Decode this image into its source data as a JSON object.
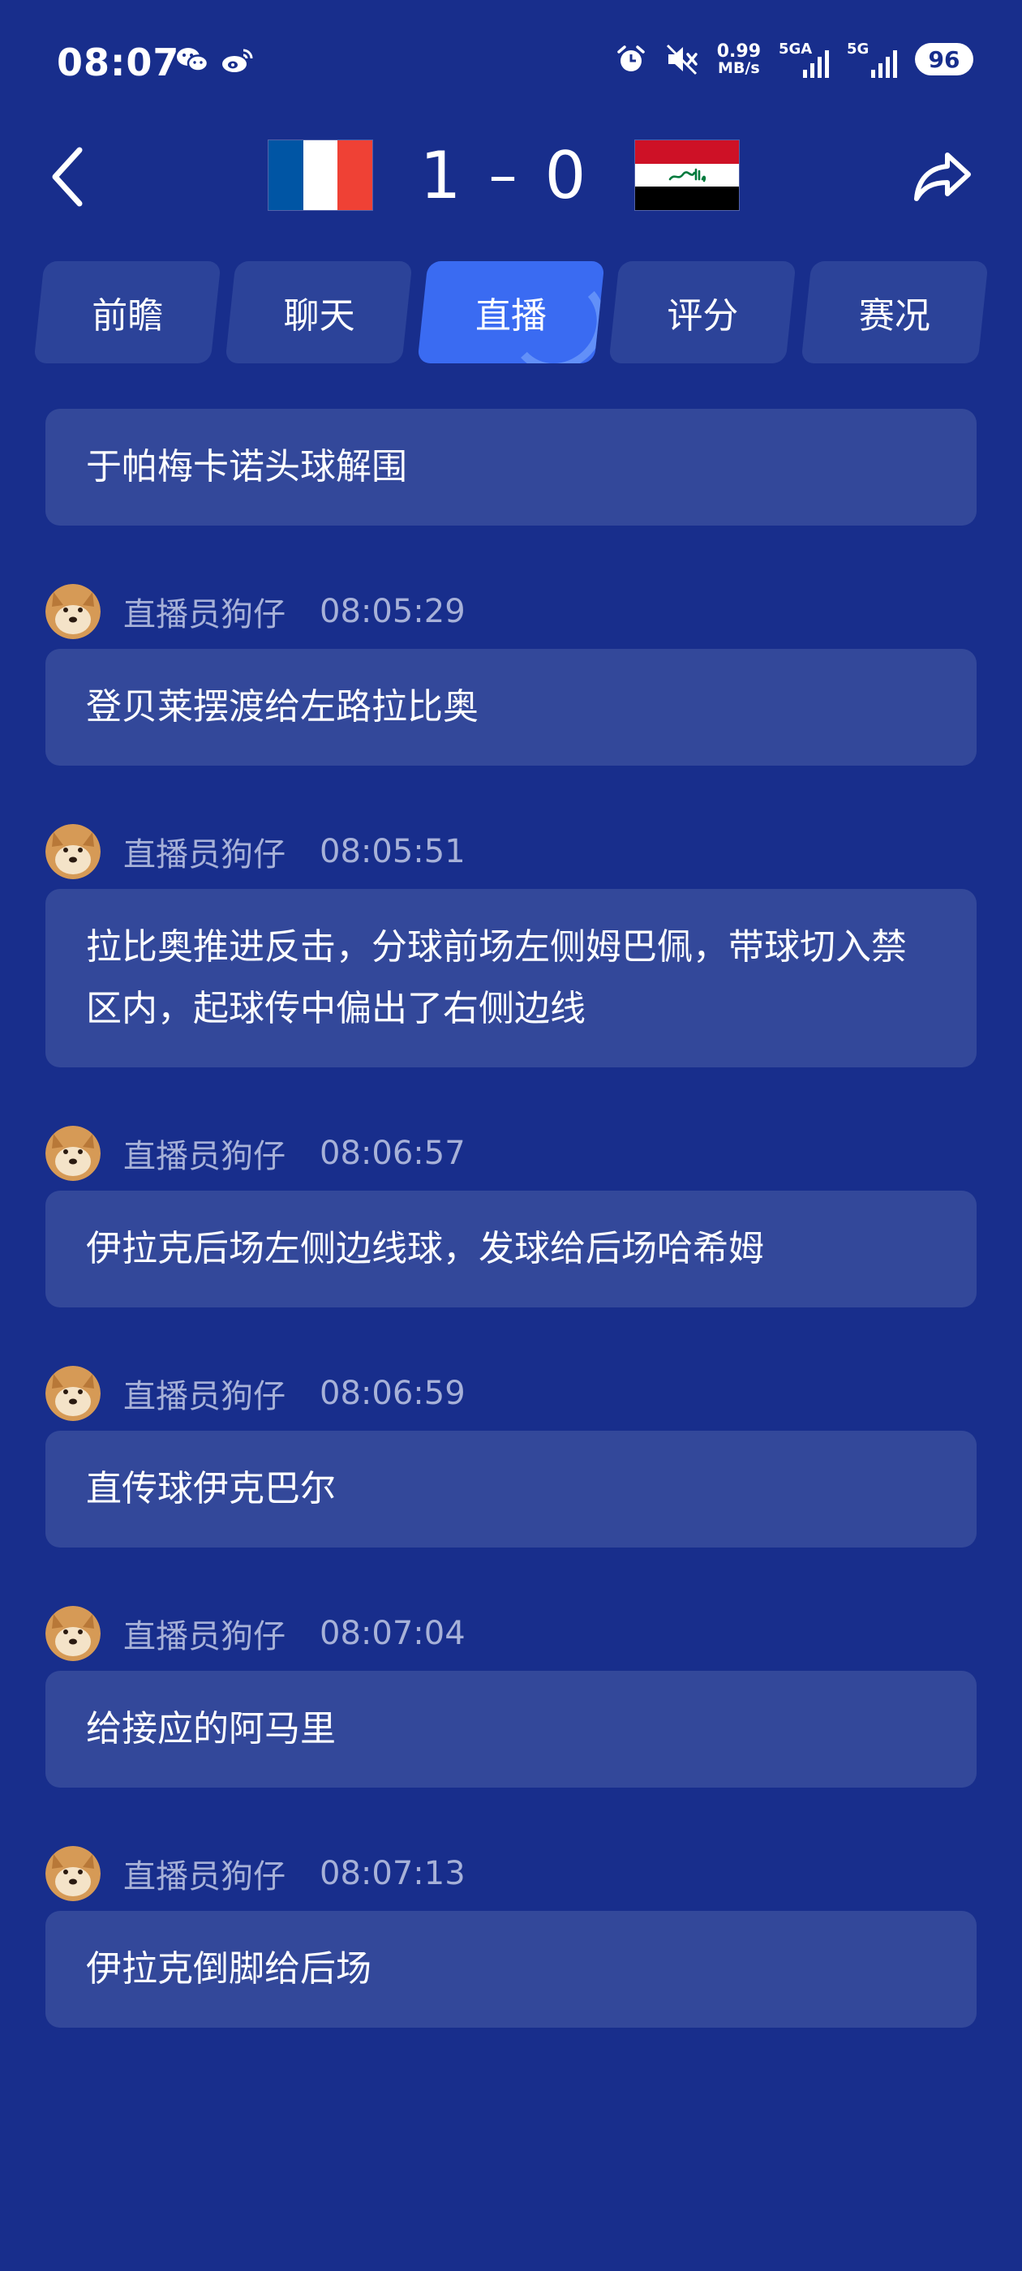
{
  "status_bar": {
    "time": "08:07",
    "app_icons": [
      "wechat-icon",
      "weibo-icon"
    ],
    "status_icons": [
      "alarm-icon",
      "mute-icon"
    ],
    "net_speed_value": "0.99",
    "net_speed_unit": "MB/s",
    "signal_1_label": "5GA",
    "signal_2_label": "5G",
    "battery": "96"
  },
  "header": {
    "back_icon": "back-arrow-icon",
    "share_icon": "share-icon",
    "home_team_flag": "france-flag",
    "away_team_flag": "iraq-flag",
    "home_score": "1",
    "separator": "–",
    "away_score": "0",
    "colors": {
      "france_blue": "#0055a4",
      "france_white": "#ffffff",
      "france_red": "#ef4135",
      "iraq_red": "#ce1126",
      "iraq_green": "#007a3d"
    }
  },
  "tabs": [
    {
      "label": "前瞻",
      "active": false
    },
    {
      "label": "聊天",
      "active": false
    },
    {
      "label": "直播",
      "active": true
    },
    {
      "label": "评分",
      "active": false
    },
    {
      "label": "赛况",
      "active": false
    }
  ],
  "feed": {
    "first_message": "于帕梅卡诺头球解围",
    "messages": [
      {
        "author": "直播员狗仔",
        "time": "08:05:29",
        "text": "登贝莱摆渡给左路拉比奥"
      },
      {
        "author": "直播员狗仔",
        "time": "08:05:51",
        "text": "拉比奥推进反击，分球前场左侧姆巴佩，带球切入禁区内，起球传中偏出了右侧边线"
      },
      {
        "author": "直播员狗仔",
        "time": "08:06:57",
        "text": "伊拉克后场左侧边线球，发球给后场哈希姆"
      },
      {
        "author": "直播员狗仔",
        "time": "08:06:59",
        "text": "直传球伊克巴尔"
      },
      {
        "author": "直播员狗仔",
        "time": "08:07:04",
        "text": "给接应的阿马里"
      },
      {
        "author": "直播员狗仔",
        "time": "08:07:13",
        "text": "伊拉克倒脚给后场"
      }
    ]
  },
  "colors": {
    "background": "#182e8c",
    "card": "#33489a",
    "tab": "#2c4399",
    "tab_active": "#3a6bf2",
    "meta_text": "#a7b1d8"
  }
}
